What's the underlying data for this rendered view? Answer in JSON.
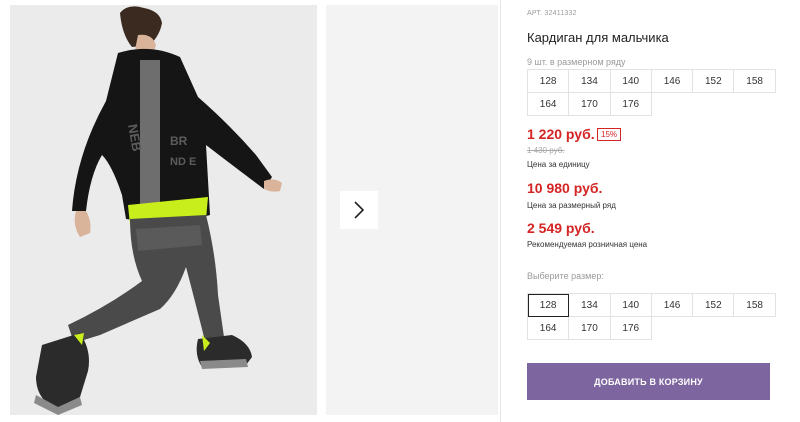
{
  "product": {
    "article": "АРТ. 32411332",
    "title": "Кардиган для мальчика"
  },
  "size_row": {
    "note": "9 шт. в размерном ряду",
    "sizes": [
      "128",
      "134",
      "140",
      "146",
      "152",
      "158",
      "164",
      "170",
      "176"
    ]
  },
  "prices": {
    "unit_price": "1 220 руб.",
    "discount": "15%",
    "old_price": "1 430 руб.",
    "unit_caption": "Цена за единицу",
    "row_price": "10 980 руб.",
    "row_caption": "Цена за размерный ряд",
    "rrp_price": "2 549 руб.",
    "rrp_caption": "Рекомендуемая розничная цена"
  },
  "size_select": {
    "label": "Выберите размер:",
    "sizes": [
      "128",
      "134",
      "140",
      "146",
      "152",
      "158",
      "164",
      "170",
      "176"
    ],
    "selected": "128"
  },
  "cart": {
    "button_label": "ДОБАВИТЬ В КОРЗИНУ",
    "button_color": "#7d659f"
  },
  "gallery": {
    "next_icon": "chevron-right-icon"
  },
  "colors": {
    "price_red": "#d42424",
    "muted_gray": "#9a9a9a"
  }
}
